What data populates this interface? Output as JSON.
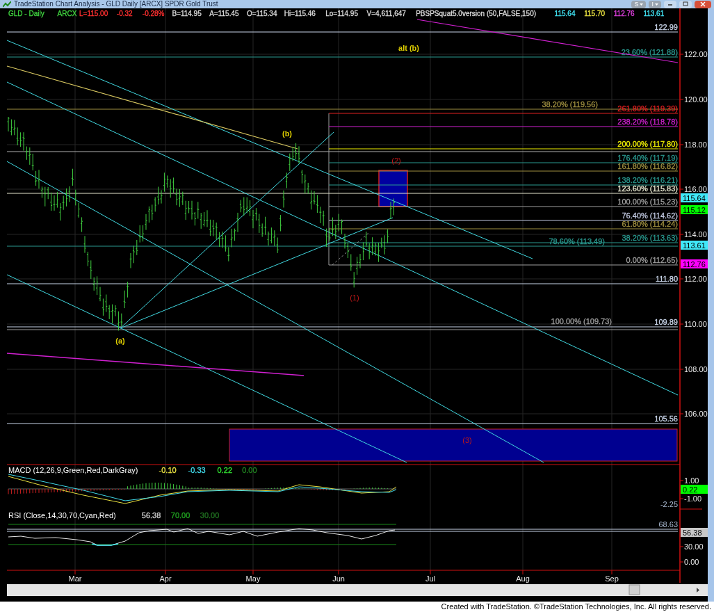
{
  "window": {
    "title": "TradeStation Chart Analysis - GLD Daily [ARCX] SPDR Gold Trust",
    "buttons": [
      "S",
      "I"
    ]
  },
  "quote_line": [
    {
      "text": "GLD - Daily",
      "color": "#3fd13f"
    },
    {
      "text": "ARCX",
      "color": "#3fd13f"
    },
    {
      "text": "L=115.00",
      "color": "#ff3030"
    },
    {
      "text": "-0.32",
      "color": "#ff3030"
    },
    {
      "text": "-0.28%",
      "color": "#ff3030"
    },
    {
      "text": "B=114.95",
      "color": "#d8d8d8"
    },
    {
      "text": "A=115.45",
      "color": "#d8d8d8"
    },
    {
      "text": "O=115.34",
      "color": "#d8d8d8"
    },
    {
      "text": "Hi=115.46",
      "color": "#d8d8d8"
    },
    {
      "text": "Lo=114.95",
      "color": "#d8d8d8"
    },
    {
      "text": "V=4,611,647",
      "color": "#d8d8d8"
    },
    {
      "text": "PBSPSquat5.0version (50,FALSE,150)",
      "color": "#d8d8d8"
    },
    {
      "text": "115.64",
      "color": "#40e0f0"
    },
    {
      "text": "115.70",
      "color": "#e8e040"
    },
    {
      "text": "112.76",
      "color": "#e040e0"
    },
    {
      "text": "113.61",
      "color": "#40e0f0"
    }
  ],
  "price_chart": {
    "level_lines": [
      {
        "label": "122.99",
        "color": "#c8d4e8"
      },
      {
        "label": "23.60% (121.88)",
        "color": "#2a9a90"
      },
      {
        "label": "38.20% (119.56)",
        "color": "#a09040"
      },
      {
        "label": "261.80% (119.39)",
        "color": "#e02020"
      },
      {
        "label": "238.20% (118.78)",
        "color": "#d020d0"
      },
      {
        "label": "200.00% (117.80)",
        "color": "#f0f000"
      },
      {
        "label": "176.40% (117.19)",
        "color": "#2a9a90"
      },
      {
        "label": "161.80% (116.82)",
        "color": "#a09040"
      },
      {
        "label": "138.20% (116.21)",
        "color": "#2a9a90"
      },
      {
        "label": "123.60% (115.83)",
        "color": "#e8e8d0"
      },
      {
        "label": "100.00% (115.23)",
        "color": "#a0a0a0"
      },
      {
        "label": "76.40% (114.62)",
        "color": "#c0c8e0"
      },
      {
        "label": "61.80% (114.24)",
        "color": "#a09040"
      },
      {
        "label": "38.20% (113.63)",
        "color": "#2a9a90"
      },
      {
        "label": "78.60% (113.49)",
        "color": "#2a9a90"
      },
      {
        "label": "0.00% (112.65)",
        "color": "#a0a0a0"
      },
      {
        "label": "111.80",
        "color": "#c8d4e8"
      },
      {
        "label": "109.89",
        "color": "#c8d4e8"
      },
      {
        "label": "100.00% (109.73)",
        "color": "#a0a0a0"
      },
      {
        "label": "105.56",
        "color": "#c8d4e8"
      }
    ],
    "wave_labels": [
      {
        "text": "alt (b)",
        "color": "#e0d000"
      },
      {
        "text": "(b)",
        "color": "#e0d000"
      },
      {
        "text": "(a)",
        "color": "#e0d000"
      },
      {
        "text": "(1)",
        "color": "#c01818"
      },
      {
        "text": "(2)",
        "color": "#c01818"
      },
      {
        "text": "(3)",
        "color": "#c01818"
      }
    ],
    "price_axis": [
      "122.00",
      "120.00",
      "118.00",
      "116.00",
      "114.00",
      "112.00",
      "110.00",
      "108.00",
      "106.00"
    ],
    "price_markers": [
      {
        "text": "115.64",
        "color": "#40e8f8"
      },
      {
        "text": "115.12",
        "color": "#00ff00"
      },
      {
        "text": "113.61",
        "color": "#40e8f8"
      },
      {
        "text": "112.76",
        "color": "#ff00ff"
      }
    ]
  },
  "macd": {
    "title": "MACD (12,26,9,Green,Red,DarkGray)",
    "values": [
      {
        "text": "-0.10",
        "color": "#e8e040"
      },
      {
        "text": "-0.33",
        "color": "#40d8e8"
      },
      {
        "text": "0.22",
        "color": "#30e030"
      },
      {
        "text": "0.00",
        "color": "#208020"
      }
    ],
    "axis": [
      "1.00",
      "-1.00"
    ],
    "marker": {
      "text": "0.22",
      "color": "#00ff00"
    },
    "level_label": "-2.25"
  },
  "rsi": {
    "title": "RSI (Close,14,30,70,Cyan,Red)",
    "values": [
      {
        "text": "56.38",
        "color": "#c8c8c8"
      },
      {
        "text": "70.00",
        "color": "#20a020"
      },
      {
        "text": "30.00",
        "color": "#207020"
      }
    ],
    "axis": [
      "30.00",
      "0.00"
    ],
    "marker": {
      "text": "56.38",
      "color": "#c8c8c8"
    },
    "level_label": "68.63"
  },
  "date_axis": [
    "Mar",
    "Apr",
    "May",
    "Jun",
    "Jul",
    "Aug",
    "Sep"
  ],
  "footer": "Created with TradeStation. ©TradeStation Technologies, Inc. All rights reserved."
}
